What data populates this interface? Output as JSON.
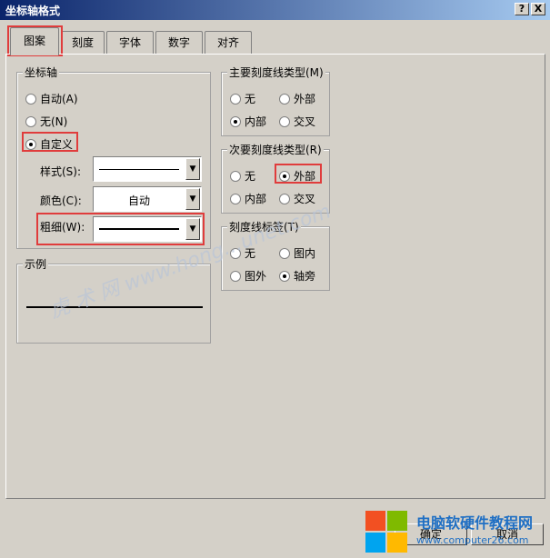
{
  "window": {
    "title": "坐标轴格式",
    "help_btn": "?",
    "close_btn": "X"
  },
  "tabs": [
    {
      "label": "图案",
      "active": true
    },
    {
      "label": "刻度",
      "active": false
    },
    {
      "label": "字体",
      "active": false
    },
    {
      "label": "数字",
      "active": false
    },
    {
      "label": "对齐",
      "active": false
    }
  ],
  "axis_group": {
    "title": "坐标轴",
    "options": [
      {
        "label": "自动(A)",
        "selected": false
      },
      {
        "label": "无(N)",
        "selected": false
      },
      {
        "label": "自定义",
        "selected": true
      }
    ],
    "style_label": "样式(S):",
    "color_label": "颜色(C):",
    "color_value": "自动",
    "weight_label": "粗细(W):"
  },
  "sample_group": {
    "title": "示例"
  },
  "major_tick": {
    "title": "主要刻度线类型(M)",
    "options": [
      {
        "label": "无",
        "selected": false
      },
      {
        "label": "外部",
        "selected": false
      },
      {
        "label": "内部",
        "selected": true
      },
      {
        "label": "交叉",
        "selected": false
      }
    ]
  },
  "minor_tick": {
    "title": "次要刻度线类型(R)",
    "options": [
      {
        "label": "无",
        "selected": false
      },
      {
        "label": "外部",
        "selected": true
      },
      {
        "label": "内部",
        "selected": false
      },
      {
        "label": "交叉",
        "selected": false
      }
    ]
  },
  "tick_labels": {
    "title": "刻度线标签(T)",
    "options": [
      {
        "label": "无",
        "selected": false
      },
      {
        "label": "图内",
        "selected": false
      },
      {
        "label": "图外",
        "selected": false
      },
      {
        "label": "轴旁",
        "selected": true
      }
    ]
  },
  "buttons": {
    "ok": "确定",
    "cancel": "取消"
  },
  "watermark": "虎 术 网   www.hong...unet.com",
  "brand": {
    "line1": "电脑软硬件教程网",
    "line2": "www.computer26.com"
  },
  "colors": {
    "highlight": "#e03c3c",
    "titlebar": "#0a246a"
  }
}
